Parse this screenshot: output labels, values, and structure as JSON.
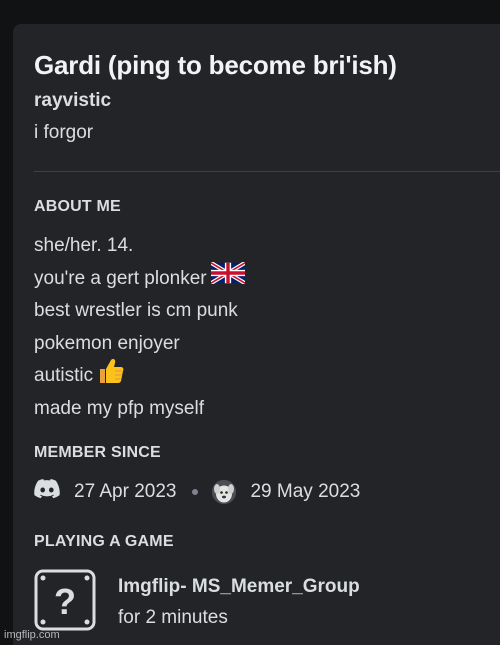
{
  "profile": {
    "display_name": "Gardi (ping to become bri'ish)",
    "username": "rayvistic",
    "custom_status": "i forgor"
  },
  "about_me": {
    "heading": "ABOUT ME",
    "lines": [
      "she/her. 14.",
      "you're a gert plonker",
      "best wrestler is cm punk",
      "pokemon enjoyer",
      "autistic",
      "made my pfp myself"
    ],
    "emoji": {
      "line_2": "uk-flag-icon",
      "line_5": "thumbs-up-icon"
    }
  },
  "member_since": {
    "heading": "MEMBER SINCE",
    "discord_date": "27 Apr 2023",
    "server_date": "29 May 2023"
  },
  "playing": {
    "heading": "PLAYING A GAME",
    "game_name": "Imgflip- MS_Memer_Group",
    "elapsed": "for 2 minutes",
    "icon": "unknown-game-icon"
  },
  "watermark": "imgflip.com",
  "colors": {
    "background": "#111214",
    "card": "#232428",
    "text_primary": "#f2f3f5",
    "text_secondary": "#dbdee1",
    "divider": "#3f4147"
  }
}
